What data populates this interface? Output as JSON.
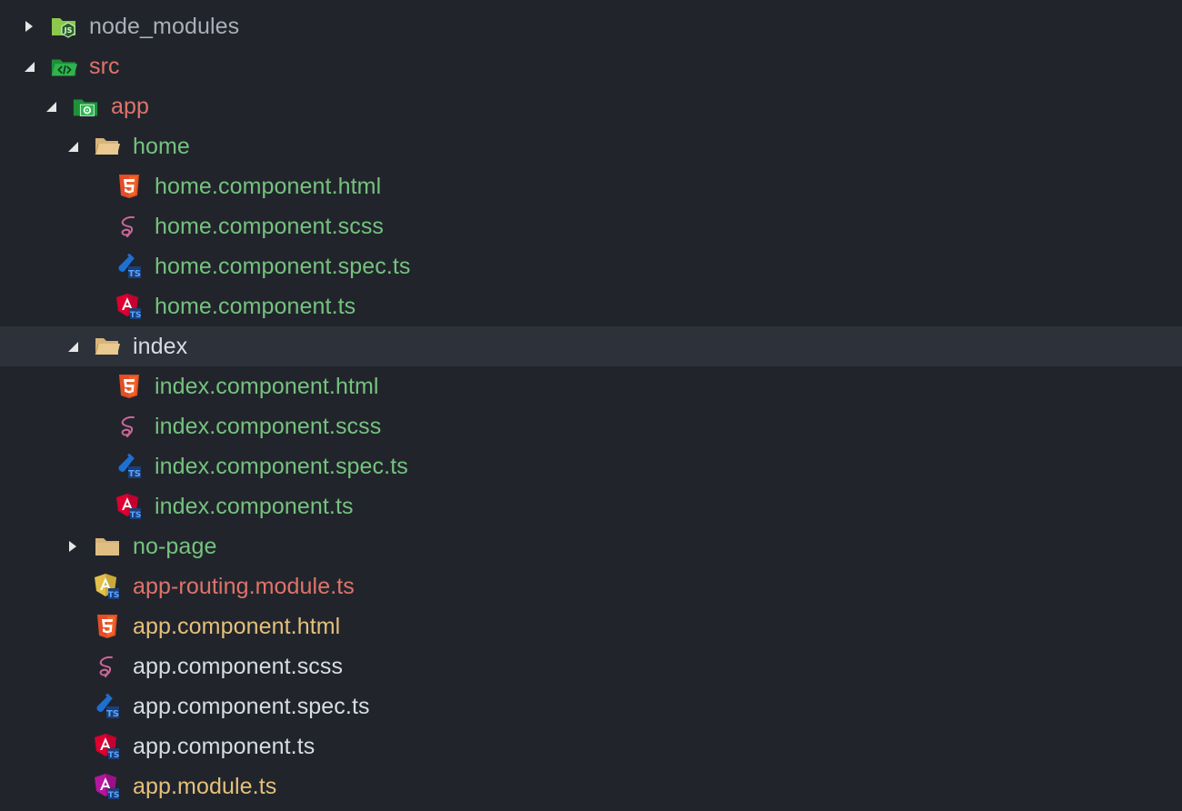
{
  "explorer": {
    "items": [
      {
        "label": "node_modules",
        "color": "gray",
        "icon": "nodejs-folder-icon",
        "arrow": "collapsed",
        "depth": 0
      },
      {
        "label": "src",
        "color": "red",
        "icon": "src-folder-icon",
        "arrow": "expanded",
        "depth": 0
      },
      {
        "label": "app",
        "color": "red",
        "icon": "app-folder-icon",
        "arrow": "expanded",
        "depth": 1
      },
      {
        "label": "home",
        "color": "green",
        "icon": "folder-open-icon",
        "arrow": "expanded",
        "depth": 2
      },
      {
        "label": "home.component.html",
        "color": "green",
        "icon": "html5-icon",
        "arrow": "none",
        "depth": 3
      },
      {
        "label": "home.component.scss",
        "color": "green",
        "icon": "sass-icon",
        "arrow": "none",
        "depth": 3
      },
      {
        "label": "home.component.spec.ts",
        "color": "green",
        "icon": "test-ts-icon",
        "arrow": "none",
        "depth": 3
      },
      {
        "label": "home.component.ts",
        "color": "green",
        "icon": "angular-component-icon",
        "arrow": "none",
        "depth": 3
      },
      {
        "label": "index",
        "color": "white",
        "icon": "folder-open-icon",
        "arrow": "expanded",
        "depth": 2,
        "selected": true
      },
      {
        "label": "index.component.html",
        "color": "green",
        "icon": "html5-icon",
        "arrow": "none",
        "depth": 3
      },
      {
        "label": "index.component.scss",
        "color": "green",
        "icon": "sass-icon",
        "arrow": "none",
        "depth": 3
      },
      {
        "label": "index.component.spec.ts",
        "color": "green",
        "icon": "test-ts-icon",
        "arrow": "none",
        "depth": 3
      },
      {
        "label": "index.component.ts",
        "color": "green",
        "icon": "angular-component-icon",
        "arrow": "none",
        "depth": 3
      },
      {
        "label": "no-page",
        "color": "green",
        "icon": "folder-closed-icon",
        "arrow": "collapsed",
        "depth": 2
      },
      {
        "label": "app-routing.module.ts",
        "color": "red",
        "icon": "angular-routing-icon",
        "arrow": "none",
        "depth": 2
      },
      {
        "label": "app.component.html",
        "color": "yellow",
        "icon": "html5-icon",
        "arrow": "none",
        "depth": 2
      },
      {
        "label": "app.component.scss",
        "color": "white",
        "icon": "sass-icon",
        "arrow": "none",
        "depth": 2
      },
      {
        "label": "app.component.spec.ts",
        "color": "white",
        "icon": "test-ts-icon",
        "arrow": "none",
        "depth": 2
      },
      {
        "label": "app.component.ts",
        "color": "white",
        "icon": "angular-component-icon",
        "arrow": "none",
        "depth": 2
      },
      {
        "label": "app.module.ts",
        "color": "yellow",
        "icon": "angular-module-icon",
        "arrow": "none",
        "depth": 2
      }
    ]
  },
  "colors": {
    "background": "#21252b",
    "selected_row": "#2c313a",
    "green": "#76c27f",
    "red": "#e0736b",
    "yellow": "#e5c07b",
    "white": "#d8dce4",
    "gray": "#a9afbb"
  }
}
